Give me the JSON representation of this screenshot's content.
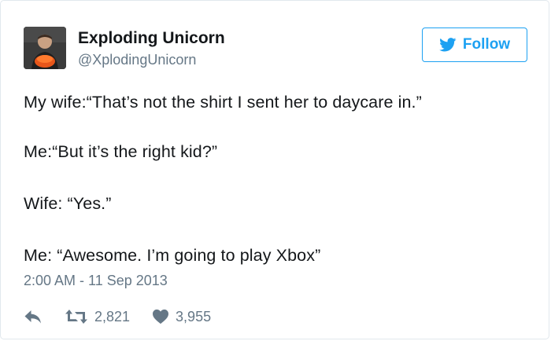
{
  "author": {
    "display_name": "Exploding Unicorn",
    "handle": "@XplodingUnicorn",
    "avatar_icon": "avatar-photo"
  },
  "follow_button": {
    "label": "Follow",
    "icon": "twitter-bird-icon",
    "color": "#1da1f2"
  },
  "tweet": {
    "lines": [
      "My wife:“That’s not the shirt I sent her to daycare in.”",
      "Me:“But it’s the right kid?”",
      "Wife: “Yes.”",
      "Me: “Awesome. I’m going to play Xbox”"
    ],
    "timestamp": "2:00 AM - 11 Sep 2013"
  },
  "actions": {
    "reply_icon": "reply-icon",
    "retweet_icon": "retweet-icon",
    "retweets": "2,821",
    "like_icon": "heart-icon",
    "likes": "3,955"
  },
  "colors": {
    "text": "#14171a",
    "secondary": "#657786",
    "accent": "#1da1f2",
    "border": "#e1e8ed"
  }
}
